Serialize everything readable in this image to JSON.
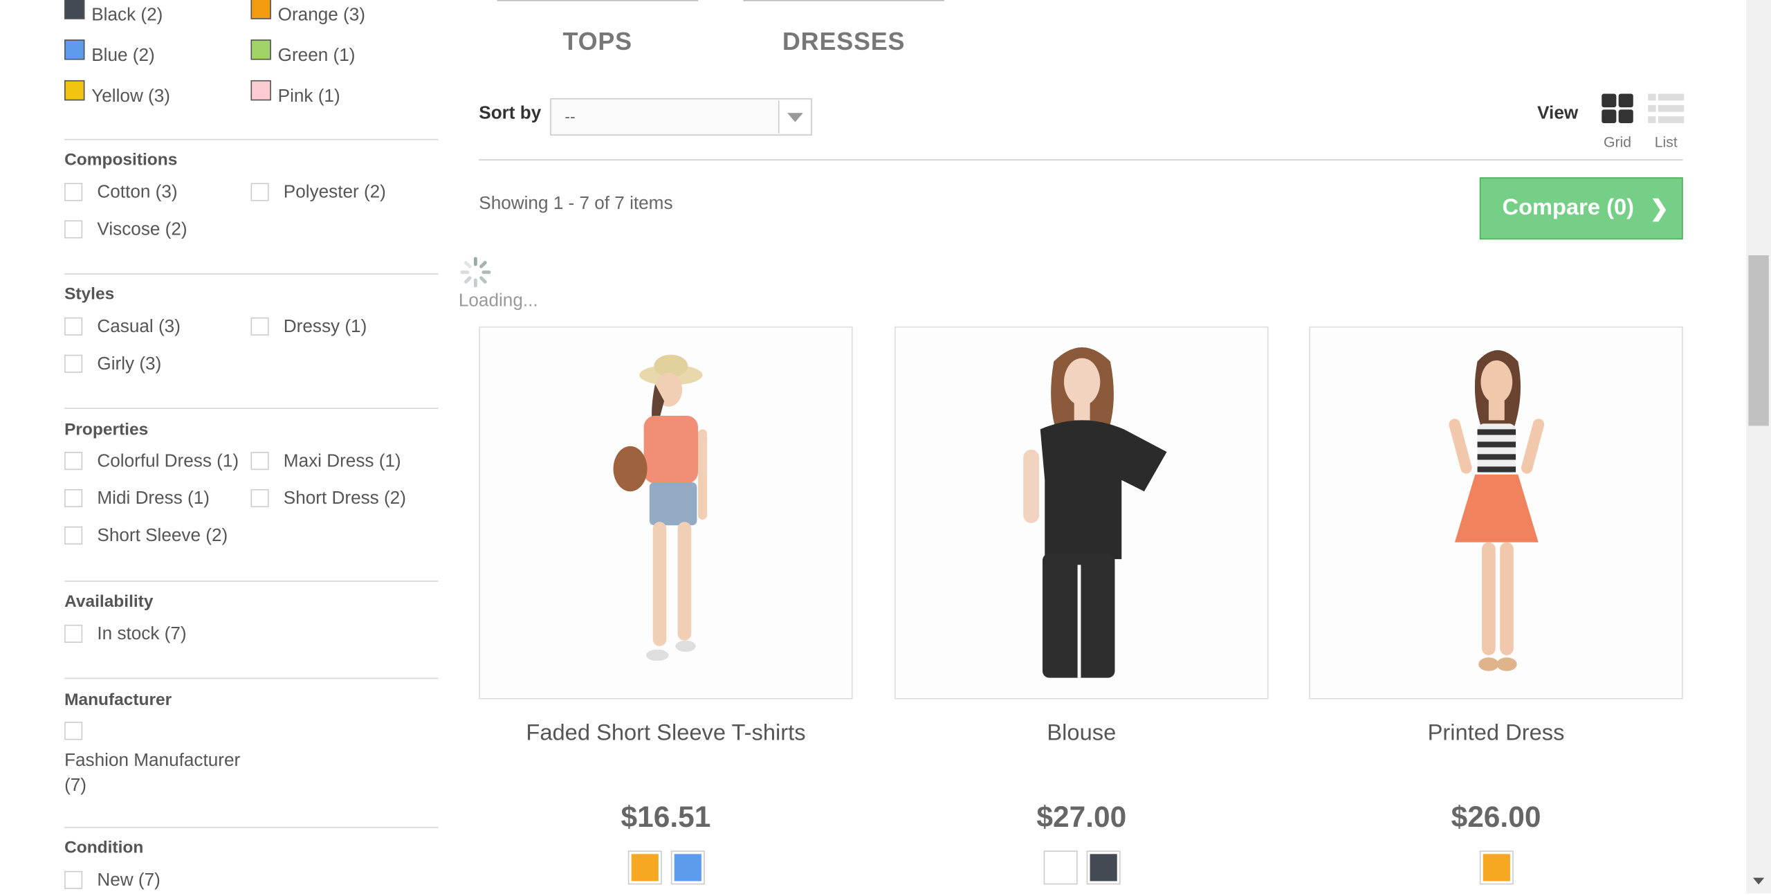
{
  "filters": {
    "colors": [
      {
        "label": "Black (2)",
        "color": "#434a54"
      },
      {
        "label": "Orange (3)",
        "color": "#f39c11"
      },
      {
        "label": "Blue (2)",
        "color": "#5d9cec"
      },
      {
        "label": "Green (1)",
        "color": "#a0d468"
      },
      {
        "label": "Yellow (3)",
        "color": "#f1c40f"
      },
      {
        "label": "Pink (1)",
        "color": "#fcccd0"
      }
    ],
    "compositions": {
      "title": "Compositions",
      "items": [
        "Cotton (3)",
        "Polyester (2)",
        "Viscose (2)"
      ]
    },
    "styles": {
      "title": "Styles",
      "items": [
        "Casual (3)",
        "Dressy (1)",
        "Girly (3)"
      ]
    },
    "properties": {
      "title": "Properties",
      "items": [
        "Colorful Dress (1)",
        "Maxi Dress (1)",
        "Midi Dress (1)",
        "Short Dress (2)",
        "Short Sleeve (2)"
      ]
    },
    "availability": {
      "title": "Availability",
      "items": [
        "In stock (7)"
      ]
    },
    "manufacturer": {
      "title": "Manufacturer",
      "line1": "Fashion Manufacturer",
      "line2": "(7)"
    },
    "condition": {
      "title": "Condition",
      "items": [
        "New (7)"
      ]
    }
  },
  "categories": [
    "TOPS",
    "DRESSES"
  ],
  "sort": {
    "label": "Sort by",
    "value": "--"
  },
  "view": {
    "label": "View",
    "grid": "Grid",
    "list": "List"
  },
  "showing": "Showing 1 - 7 of 7 items",
  "compare": {
    "label": "Compare (0)",
    "icon": "chevron-right-icon"
  },
  "loading": "Loading...",
  "products": [
    {
      "name": "Faded Short Sleeve T-shirts",
      "price": "$16.51",
      "colors": [
        "#f6a823",
        "#5d9cec"
      ]
    },
    {
      "name": "Blouse",
      "price": "$27.00",
      "colors": [
        "#ffffff",
        "#434a54"
      ]
    },
    {
      "name": "Printed Dress",
      "price": "$26.00",
      "colors": [
        "#f6a823"
      ]
    }
  ]
}
